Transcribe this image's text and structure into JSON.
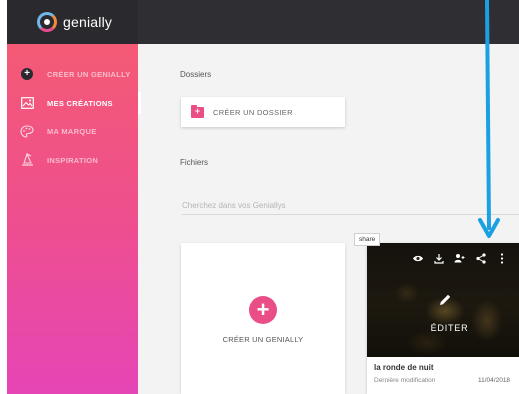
{
  "app": {
    "logo_text": "genially"
  },
  "sidebar": {
    "items": [
      {
        "label": "CRÉER UN GENIALLY",
        "icon": "plus-circle-icon",
        "active": false
      },
      {
        "label": "MES CRÉATIONS",
        "icon": "image-icon",
        "active": true
      },
      {
        "label": "MA MARQUE",
        "icon": "palette-icon",
        "active": false
      },
      {
        "label": "INSPIRATION",
        "icon": "wizard-hat-icon",
        "active": false
      }
    ]
  },
  "main": {
    "folders_title": "Dossiers",
    "create_folder_label": "CRÉER UN DOSSIER",
    "files_title": "Fichiers",
    "search_placeholder": "Cherchez dans vos Geniallys",
    "create_card_label": "CRÉER UN GENIALLY",
    "card": {
      "edit_label": "ÉDITER",
      "title": "la ronde de nuit",
      "subtitle": "Dernière modification",
      "date": "11/04/2018",
      "toolbar": [
        "eye-icon",
        "download-icon",
        "add-user-icon",
        "share-icon",
        "more-icon"
      ],
      "tooltip": "share"
    }
  },
  "colors": {
    "accent": "#e94e86",
    "topbar": "#2f2f33",
    "annotation_arrow": "#1ba1e2"
  }
}
